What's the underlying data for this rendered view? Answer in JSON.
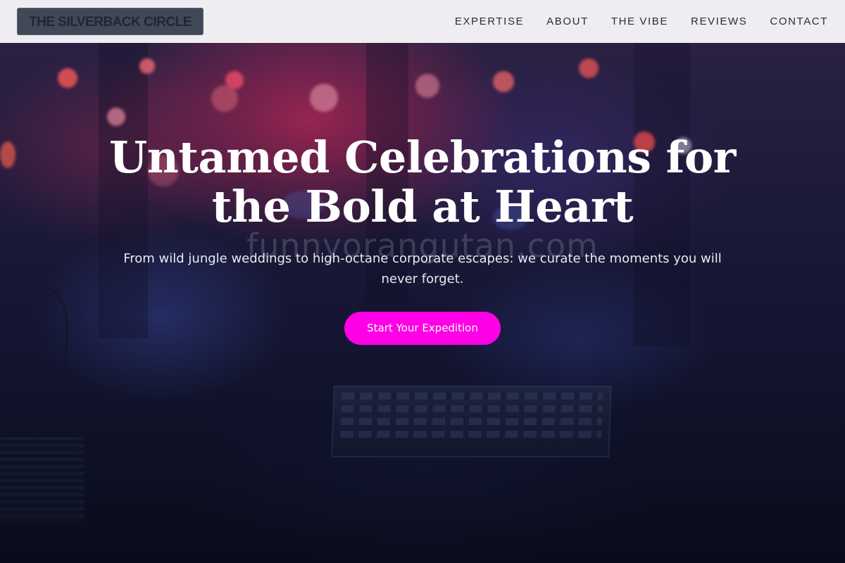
{
  "header": {
    "logo_text": "THE SILVERBACK CIRCLE",
    "nav": [
      {
        "label": "EXPERTISE"
      },
      {
        "label": "ABOUT"
      },
      {
        "label": "THE VIBE"
      },
      {
        "label": "REVIEWS"
      },
      {
        "label": "CONTACT"
      }
    ]
  },
  "hero": {
    "title": "Untamed Celebrations for the Bold at Heart",
    "subtitle": "From wild jungle weddings to high-octane corporate escapes: we curate the moments you will never forget.",
    "cta_label": "Start Your Expedition",
    "watermark": "funnyorangutan.com"
  },
  "colors": {
    "header_bg": "#efedf1",
    "logo_bg": "#414857",
    "cta_bg": "#ff00e6",
    "hero_text": "#ffffff"
  }
}
